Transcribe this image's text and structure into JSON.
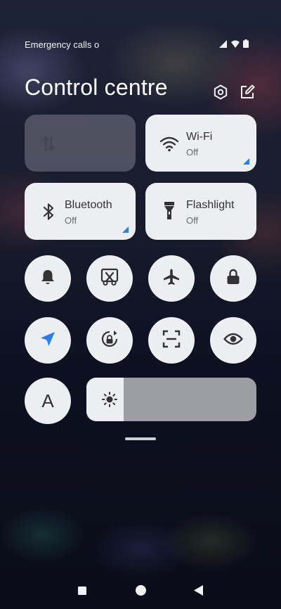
{
  "status_bar": {
    "carrier_text": "Emergency calls o",
    "icons": [
      "signal-icon",
      "wifi-icon",
      "battery-icon"
    ]
  },
  "header": {
    "title": "Control centre",
    "actions": [
      "settings-icon",
      "edit-icon"
    ]
  },
  "tiles": [
    {
      "name": "mobile-data",
      "icon": "data-transfer-icon",
      "label": "",
      "status": "",
      "active": false
    },
    {
      "name": "wifi",
      "icon": "wifi-icon",
      "label": "Wi-Fi",
      "status": "Off",
      "active": false
    },
    {
      "name": "bluetooth",
      "icon": "bluetooth-icon",
      "label": "Bluetooth",
      "status": "Off",
      "active": false
    },
    {
      "name": "flashlight",
      "icon": "flashlight-icon",
      "label": "Flashlight",
      "status": "Off",
      "active": false
    }
  ],
  "toggles_row1": [
    "bell-icon",
    "screenshot-icon",
    "airplane-icon",
    "lock-icon"
  ],
  "toggles_row2": [
    "location-icon",
    "rotation-lock-icon",
    "scanner-icon",
    "eye-icon"
  ],
  "font_toggle": {
    "icon": "font-icon",
    "glyph": "A"
  },
  "brightness": {
    "icon": "brightness-icon",
    "level": 0.22
  },
  "colors": {
    "accent": "#2a7ff0",
    "tile_bg": "#eceef2",
    "slider_track": "#9d9ea3"
  },
  "nav": [
    "recents-button",
    "home-button",
    "back-button"
  ]
}
